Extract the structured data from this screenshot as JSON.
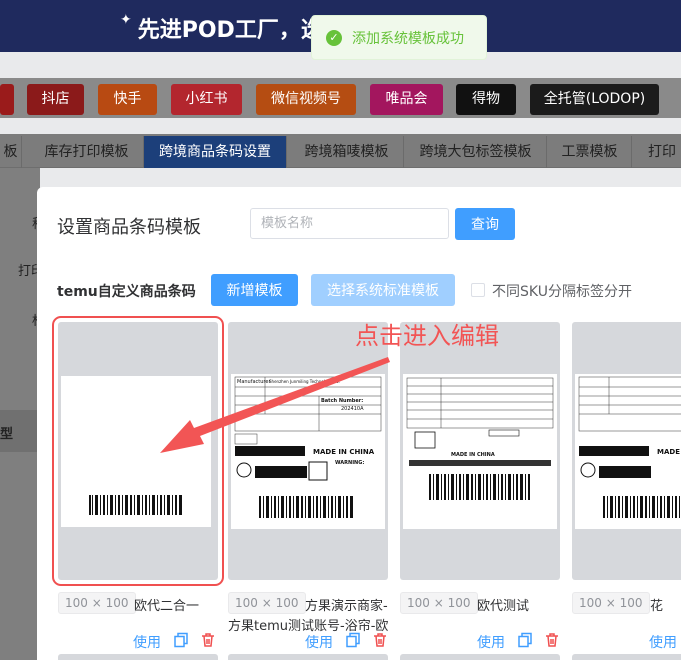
{
  "banner": {
    "text": "先进POD工厂，选"
  },
  "toast": {
    "message": "添加系统模板成功"
  },
  "platforms": [
    {
      "label": "抖店",
      "color": "#8b1a1a"
    },
    {
      "label": "快手",
      "color": "#b84a12"
    },
    {
      "label": "小红书",
      "color": "#b3262e"
    },
    {
      "label": "微信视频号",
      "color": "#b54d12"
    },
    {
      "label": "唯品会",
      "color": "#a3165e"
    },
    {
      "label": "得物",
      "color": "#111111"
    },
    {
      "label": "全托管(LODOP)",
      "color": "#1b1b1b"
    }
  ],
  "tabs": [
    {
      "label": "板"
    },
    {
      "label": "库存打印模板"
    },
    {
      "label": "跨境商品条码设置",
      "active": true
    },
    {
      "label": "跨境箱唛模板"
    },
    {
      "label": "跨境大包标签模板"
    },
    {
      "label": "工票模板"
    },
    {
      "label": "打印"
    }
  ],
  "background_labels": {
    "side1": "称",
    "side2": "打印",
    "side3": "标",
    "side4": "型"
  },
  "dialog": {
    "title": "设置商品条码模板",
    "search_placeholder": "模板名称",
    "search_button": "查询",
    "section_label": "temu自定义商品条码",
    "add_button": "新增模板",
    "system_button": "选择系统标准模板",
    "checkbox_label": "不同SKU分隔标签分开",
    "annotation": "点击进入编辑"
  },
  "cards": [
    {
      "size": "100 × 100",
      "name": "欧代二合一",
      "name2": "",
      "use": "使用",
      "selected": true
    },
    {
      "size": "100 × 100",
      "name": "方果演示商家-",
      "name2": "方果temu测试账号-浴帘-欧",
      "use": "使用"
    },
    {
      "size": "100 × 100",
      "name": "欧代测试",
      "name2": "",
      "use": "使用"
    },
    {
      "size": "100 × 100",
      "name": "花",
      "name2": "",
      "use": "使用"
    }
  ],
  "label_text": {
    "manufacturer": "Manufacturer",
    "company": "Shenzhen Junmiling Technology Co.",
    "made_in_china": "MADE IN CHINA",
    "warning": "WARNING:",
    "batch": "Batch Number:",
    "batch_value": "202410A"
  },
  "colors": {
    "primary": "#409eff",
    "primary_light": "#a0cfff",
    "danger": "#f05050",
    "success": "#67c23a"
  }
}
